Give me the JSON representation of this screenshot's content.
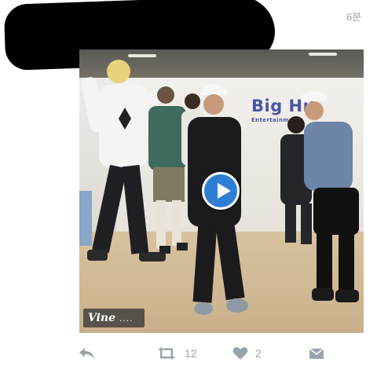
{
  "tweet": {
    "timestamp": "6분"
  },
  "media": {
    "logo_text": "Big Hit",
    "logo_sub": "Entertainment",
    "vine_label": "Vine",
    "vine_dots": "...."
  },
  "actions": {
    "retweet_count": "12",
    "like_count": "2"
  },
  "icons": {
    "reply": "reply-icon",
    "retweet": "retweet-icon",
    "like": "heart-icon",
    "dm": "envelope-icon",
    "play": "play-icon"
  },
  "colors": {
    "action_gray": "#9aa4ad",
    "play_blue": "#2d7fd3",
    "logo_blue": "#4a56a5"
  }
}
